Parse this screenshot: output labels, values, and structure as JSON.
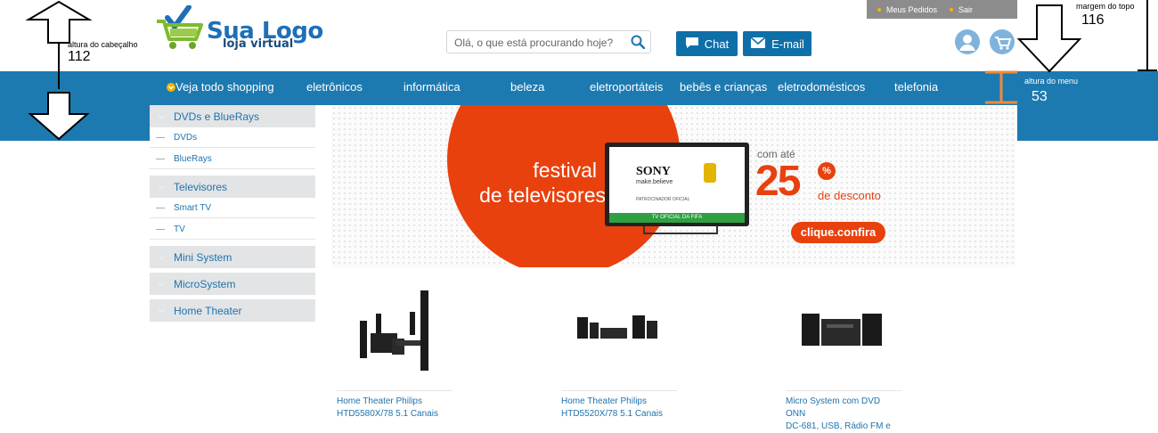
{
  "header": {
    "userbar": {
      "meus_pedidos": "Meus Pedidos",
      "sair": "Sair"
    },
    "logo": {
      "title": "Sua Logo",
      "subtitle": "loja virtual"
    },
    "search": {
      "placeholder": "Olá, o que está procurando hoje?"
    },
    "buttons": {
      "chat": "Chat",
      "email": "E-mail"
    }
  },
  "nav": {
    "items": [
      {
        "label": "Veja todo shopping"
      },
      {
        "label": "eletrônicos"
      },
      {
        "label": "informática"
      },
      {
        "label": "beleza"
      },
      {
        "label": "eletroportáteis"
      },
      {
        "label": "bebês e crianças"
      },
      {
        "label": "eletrodomésticos"
      },
      {
        "label": "telefonia"
      }
    ]
  },
  "sidebar": {
    "groups": [
      {
        "label": "DVDs e BlueRays",
        "items": [
          "DVDs",
          "BlueRays"
        ]
      },
      {
        "label": "Televisores",
        "items": [
          "Smart TV",
          "TV"
        ]
      },
      {
        "label": "Mini System",
        "items": []
      },
      {
        "label": "MicroSystem",
        "items": []
      },
      {
        "label": "Home Theater",
        "items": []
      }
    ]
  },
  "banner": {
    "line1": "festival",
    "line2": "de televisores",
    "brand": "SONY",
    "brand_tagline": "make.believe",
    "sponsor": "PATROCINADOR OFICIAL",
    "tv_strip": "TV OFICIAL DA FIFA",
    "com_ate": "com até",
    "percent": "25",
    "percent_sign": "%",
    "desconto": "de desconto",
    "cta": "clique.confira"
  },
  "products": [
    {
      "line1": "Home Theater Philips",
      "line2": "HTD5580X/78 5.1 Canais"
    },
    {
      "line1": "Home Theater Philips",
      "line2": "HTD5520X/78 5.1 Canais"
    },
    {
      "line1": "Micro System com DVD ONN",
      "line2": "DC-681, USB, Rádio FM e"
    }
  ],
  "annotations": {
    "header_height_label": "altura do cabeçalho",
    "header_height_value": "112",
    "top_margin_label": "margem do topo",
    "top_margin_value": "116",
    "menu_height_label": "altura do menu",
    "menu_height_value": "53"
  },
  "colors": {
    "nav_blue": "#1d7ab0",
    "button_blue": "#0f6fa9",
    "banner_orange": "#e8410e",
    "link_blue": "#1e73ad",
    "annotation_orange": "#f08a3c"
  }
}
